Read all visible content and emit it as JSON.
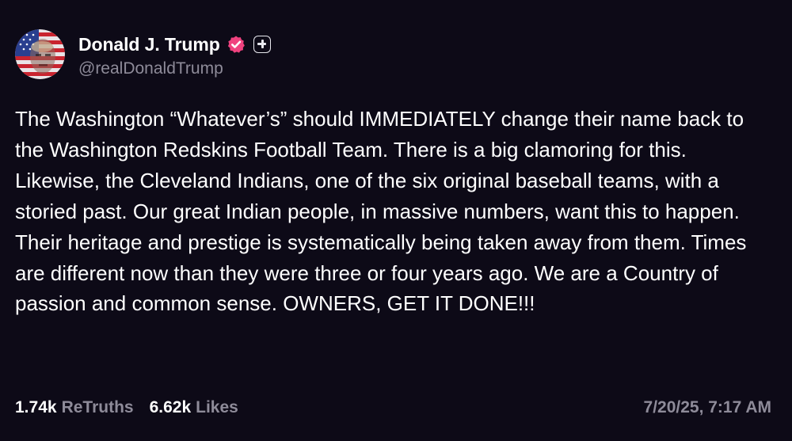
{
  "author": {
    "display_name": "Donald J. Trump",
    "handle": "@realDonaldTrump",
    "avatar_icon": "flag-portrait-avatar",
    "verified_icon": "verified-badge-icon",
    "verified_color": "#f0427f",
    "plus_icon": "plus-badge-icon"
  },
  "post": {
    "text": "The Washington “Whatever’s” should IMMEDIATELY change their name back to the Washington Redskins Football Team. There is a big clamoring for this. Likewise, the Cleveland Indians, one of the six original baseball teams, with a storied past. Our great Indian people, in massive numbers, want this to happen. Their heritage and prestige is systematically being taken away from them. Times are different now than they were three or four years ago. We are a Country of passion and common sense. OWNERS, GET IT DONE!!!"
  },
  "stats": {
    "retruths_count": "1.74k",
    "retruths_label": "ReTruths",
    "likes_count": "6.62k",
    "likes_label": "Likes"
  },
  "timestamp": "7/20/25, 7:17 AM",
  "colors": {
    "background": "#0d0a17",
    "text": "#ffffff",
    "muted": "#8e8b99"
  }
}
